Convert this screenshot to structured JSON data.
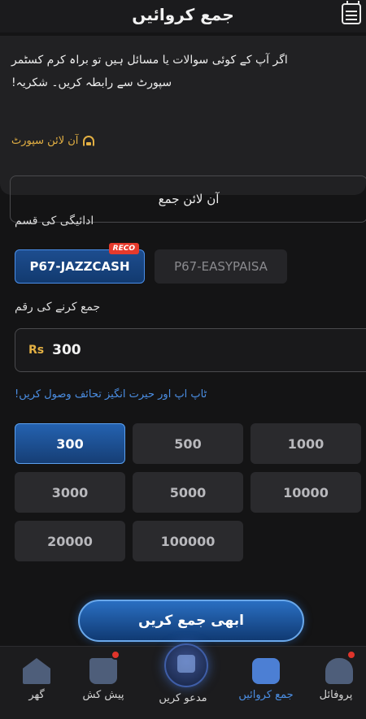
{
  "header": {
    "title": "جمع کروائیں"
  },
  "notice": {
    "line1": "اگر آپ کے کوئی سوالات یا مسائل ہیں تو براہ کرم کسٹمر",
    "line2": "سپورٹ سے رابطہ کریں۔ شکریہ!",
    "support_link": "آن لائن سپورٹ",
    "online_deposit": "آن لائن جمع"
  },
  "payment": {
    "label": "ادائیگی کی قسم",
    "methods": [
      {
        "label": "P67-JAZZCASH",
        "badge": "RECO",
        "selected": true
      },
      {
        "label": "P67-EASYPAISA",
        "selected": false
      }
    ]
  },
  "amount": {
    "label": "جمع کرنے کی رقم",
    "currency": "Rs",
    "value": "300",
    "promo": "ٹاپ اپ اور حیرت انگیز تحائف وصول کریں!"
  },
  "chips": [
    "300",
    "500",
    "1000",
    "3000",
    "5000",
    "10000",
    "20000",
    "100000"
  ],
  "cta": "ابھی جمع کریں",
  "nav": {
    "home": "گھر",
    "withdraw": "پیش کش",
    "invite": "مدعو کریں",
    "deposit": "جمع کروائیں",
    "profile": "پروفائل"
  },
  "colors": {
    "accent_blue": "#4b8ee3",
    "gold": "#e3b043",
    "badge_red": "#e53a2c"
  },
  "icons": [
    "menu-list-icon",
    "headset-icon",
    "home-icon",
    "gift-box-icon",
    "treasure-chest-icon",
    "wallet-icon",
    "profile-icon"
  ]
}
